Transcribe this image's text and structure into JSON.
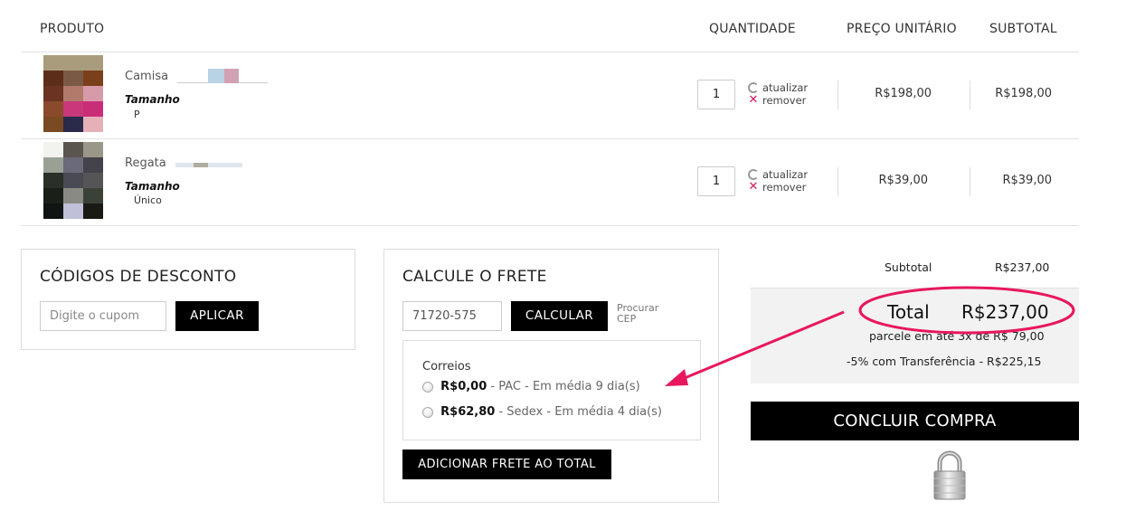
{
  "cart": {
    "headers": {
      "product": "PRODUTO",
      "quantity": "QUANTIDADE",
      "unit_price": "PREÇO UNITÁRIO",
      "subtotal": "SUBTOTAL"
    },
    "items": [
      {
        "name": "Camisa",
        "size_label": "Tamanho",
        "size": "P",
        "qty": "1",
        "update": "atualizar",
        "remove": "remover",
        "unit_price": "R$198,00",
        "subtotal": "R$198,00"
      },
      {
        "name": "Regata",
        "size_label": "Tamanho",
        "size": "Único",
        "qty": "1",
        "update": "atualizar",
        "remove": "remover",
        "unit_price": "R$39,00",
        "subtotal": "R$39,00"
      }
    ]
  },
  "discount": {
    "title": "CÓDIGOS DE DESCONTO",
    "placeholder": "Digite o cupom",
    "apply": "APLICAR"
  },
  "shipping": {
    "title": "CALCULE O FRETE",
    "cep_value": "71720-575",
    "calculate": "CALCULAR",
    "find_cep_line1": "Procurar",
    "find_cep_line2": "CEP",
    "carrier": "Correios",
    "options": [
      {
        "price": "R$0,00",
        "desc": " - PAC - Em média 9 dia(s)"
      },
      {
        "price": "R$62,80",
        "desc": " - Sedex - Em média 4 dia(s)"
      }
    ],
    "add_button": "ADICIONAR FRETE AO TOTAL"
  },
  "summary": {
    "subtotal_label": "Subtotal",
    "subtotal_value": "R$237,00",
    "total_label": "Total",
    "total_value": "R$237,00",
    "installments": "parcele em até 3x de R$ 79,00",
    "transfer": "-5% com Transferência - R$225,15",
    "checkout": "CONCLUIR COMPRA"
  },
  "colors": {
    "annotation": "#e8175d",
    "button_bg": "#000000"
  }
}
